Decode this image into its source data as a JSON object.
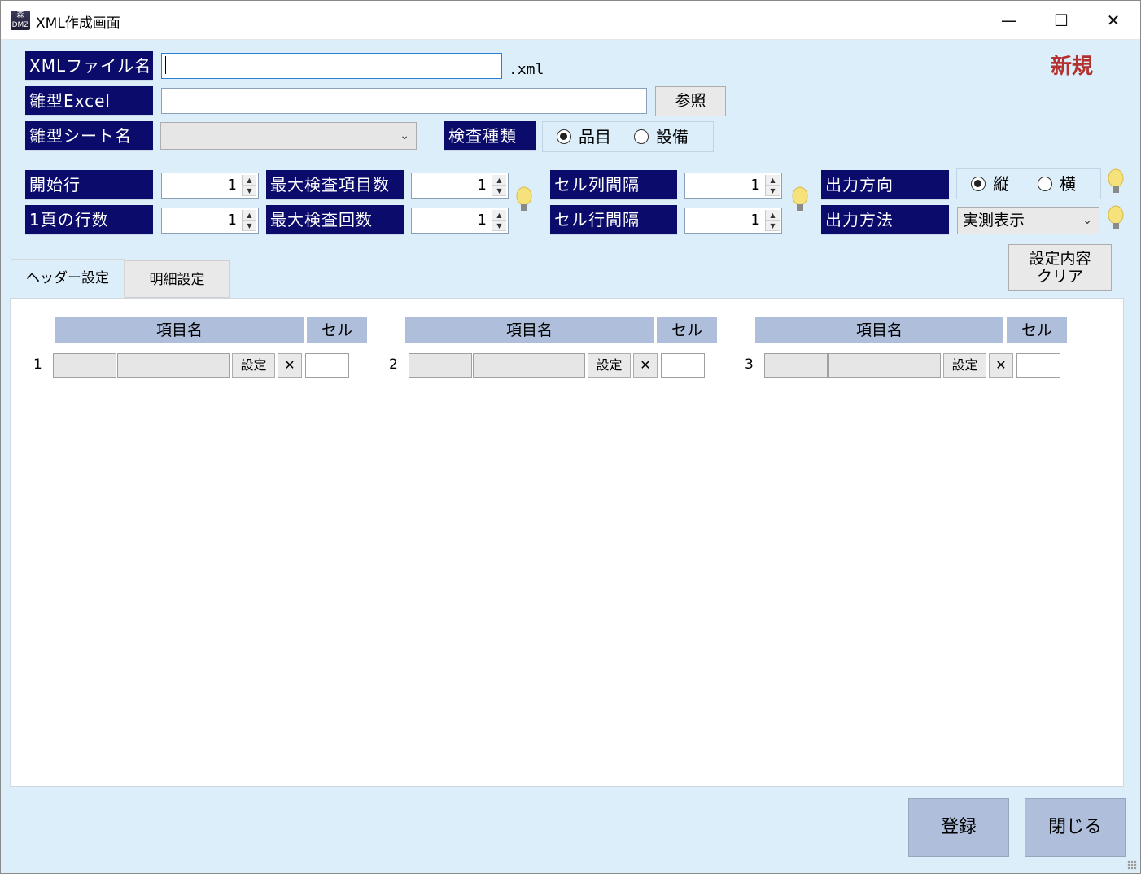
{
  "window": {
    "title": "XML作成画面",
    "app_icon_lines": [
      "森",
      "DMZ"
    ],
    "minimize": "—",
    "maximize": "☐",
    "close": "✕"
  },
  "status": {
    "mode": "新規"
  },
  "form": {
    "xml_file_label": "XMLファイル名",
    "xml_file_value": "",
    "xml_suffix": ".xml",
    "template_excel_label": "雛型Excel",
    "template_excel_value": "",
    "browse_button": "参照",
    "template_sheet_label": "雛型シート名",
    "template_sheet_selected": "",
    "inspection_type_label": "検査種類",
    "inspection_type_options": [
      "品目",
      "設備"
    ],
    "inspection_type_selected": "品目",
    "start_row_label": "開始行",
    "start_row_value": "1",
    "rows_per_page_label": "1頁の行数",
    "rows_per_page_value": "1",
    "max_items_label": "最大検査項目数",
    "max_items_value": "1",
    "max_count_label": "最大検査回数",
    "max_count_value": "1",
    "cell_col_interval_label": "セル列間隔",
    "cell_col_interval_value": "1",
    "cell_row_interval_label": "セル行間隔",
    "cell_row_interval_value": "1",
    "output_direction_label": "出力方向",
    "output_direction_options": [
      "縦",
      "横"
    ],
    "output_direction_selected": "縦",
    "output_method_label": "出力方法",
    "output_method_selected": "実測表示",
    "clear_button_line1": "設定内容",
    "clear_button_line2": "クリア"
  },
  "tabs": [
    {
      "label": "ヘッダー設定",
      "active": true
    },
    {
      "label": "明細設定",
      "active": false
    }
  ],
  "header_grid": {
    "col_item_name": "項目名",
    "col_cell": "セル",
    "rows": [
      {
        "number": "1",
        "set_button": "設定",
        "delete_button": "✕"
      },
      {
        "number": "2",
        "set_button": "設定",
        "delete_button": "✕"
      },
      {
        "number": "3",
        "set_button": "設定",
        "delete_button": "✕"
      }
    ]
  },
  "footer": {
    "register_button": "登録",
    "close_button": "閉じる"
  },
  "colors": {
    "label_bg": "#0b0b6b",
    "window_bg": "#dceefa",
    "header_bg": "#aebedb",
    "mode_text": "#b3312e"
  }
}
